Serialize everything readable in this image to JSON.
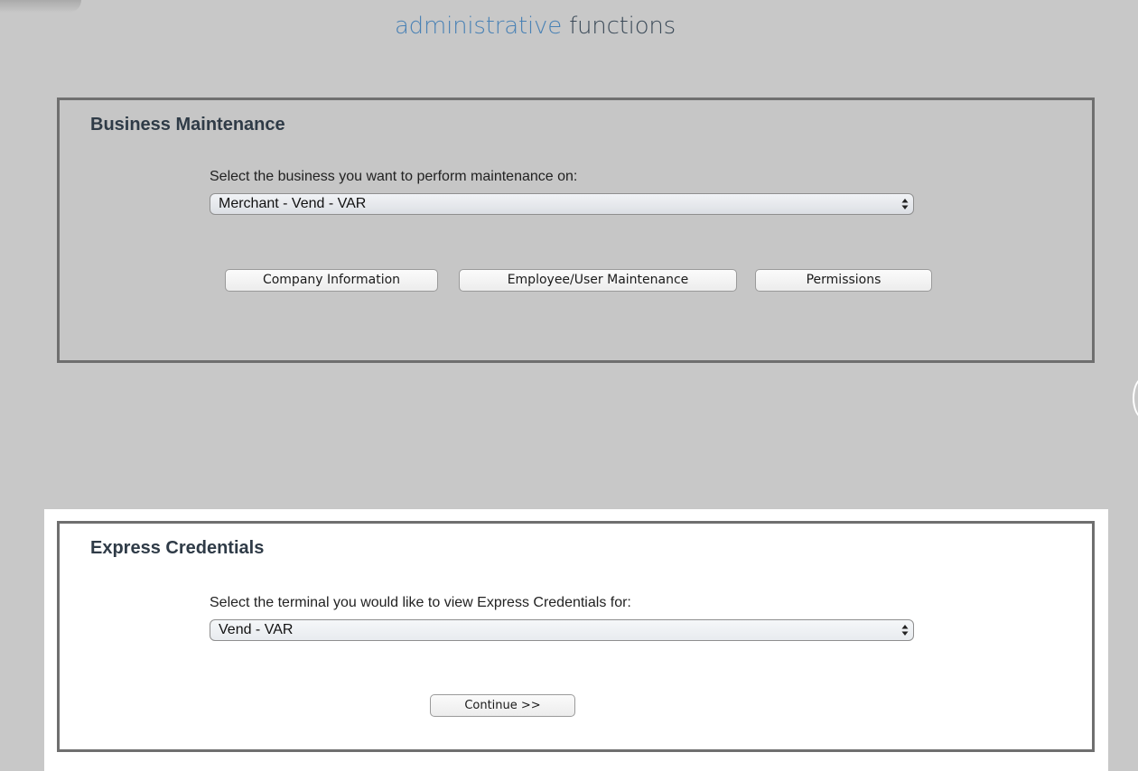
{
  "header": {
    "title_part1": "administrative",
    "title_part2": "functions"
  },
  "business_maintenance": {
    "heading": "Business Maintenance",
    "prompt": "Select the business you want to perform maintenance on:",
    "selected_business": "Merchant - Vend - VAR",
    "buttons": {
      "company_info": "Company Information",
      "employee_user": "Employee/User Maintenance",
      "permissions": "Permissions"
    }
  },
  "express_credentials": {
    "heading": "Express Credentials",
    "prompt": "Select the terminal you would like to view Express Credentials for:",
    "selected_terminal": "Vend - VAR",
    "continue_label": "Continue >>"
  },
  "colors": {
    "page_background": "#c8c8c8",
    "title_accent": "#4a82b5",
    "title_dark": "#3b4a58",
    "panel_border": "#6f6f6f"
  },
  "icons": {
    "select_arrows": "up-down-arrows-icon"
  }
}
